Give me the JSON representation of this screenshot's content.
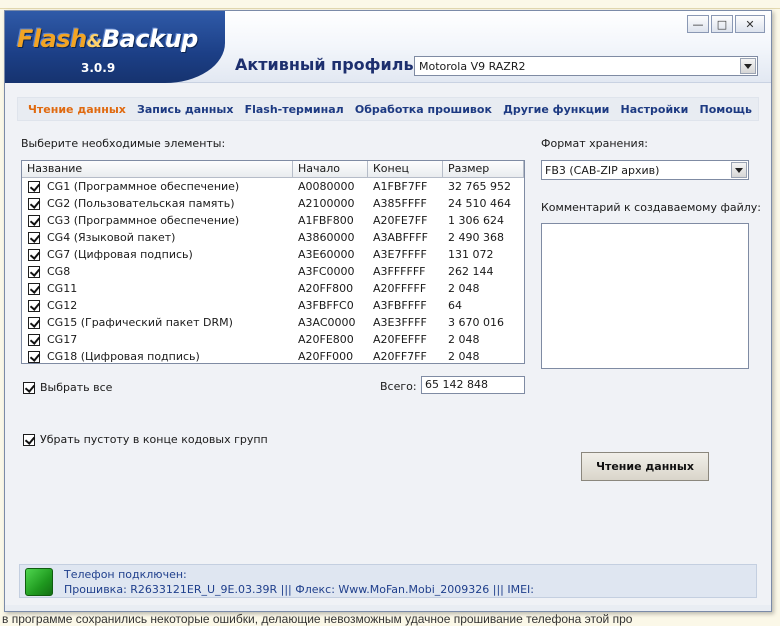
{
  "window": {
    "logo": {
      "part1": "Flash",
      "amp": "&",
      "part2": "Backup",
      "version": "3.0.9"
    },
    "buttons": {
      "minimize": "—",
      "maximize": "□",
      "close": "✕"
    }
  },
  "profile": {
    "label": "Активный профиль:",
    "selected": "Motorola V9 RAZR2"
  },
  "menu": [
    {
      "label": "Чтение данных",
      "active": true
    },
    {
      "label": "Запись данных",
      "active": false
    },
    {
      "label": "Flash-терминал",
      "active": false
    },
    {
      "label": "Обработка прошивок",
      "active": false
    },
    {
      "label": "Другие функции",
      "active": false
    },
    {
      "label": "Настройки",
      "active": false
    },
    {
      "label": "Помощь",
      "active": false
    }
  ],
  "main": {
    "select_label": "Выберите необходимые элементы:",
    "table": {
      "headers": [
        "Название",
        "Начало",
        "Конец",
        "Размер"
      ],
      "rows": [
        {
          "name": "CG1 (Программное обеспечение)",
          "start": "A0080000",
          "end": "A1FBF7FF",
          "size": "32 765 952",
          "checked": true
        },
        {
          "name": "CG2 (Пользовательская память)",
          "start": "A2100000",
          "end": "A385FFFF",
          "size": "24 510 464",
          "checked": true
        },
        {
          "name": "CG3 (Программное обеспечение)",
          "start": "A1FBF800",
          "end": "A20FE7FF",
          "size": "1 306 624",
          "checked": true
        },
        {
          "name": "CG4 (Языковой пакет)",
          "start": "A3860000",
          "end": "A3ABFFFF",
          "size": "2 490 368",
          "checked": true
        },
        {
          "name": "CG7 (Цифровая подпись)",
          "start": "A3E60000",
          "end": "A3E7FFFF",
          "size": "131 072",
          "checked": true
        },
        {
          "name": "CG8",
          "start": "A3FC0000",
          "end": "A3FFFFFF",
          "size": "262 144",
          "checked": true
        },
        {
          "name": "CG11",
          "start": "A20FF800",
          "end": "A20FFFFF",
          "size": "2 048",
          "checked": true
        },
        {
          "name": "CG12",
          "start": "A3FBFFC0",
          "end": "A3FBFFFF",
          "size": "64",
          "checked": true
        },
        {
          "name": "CG15 (Графический пакет DRM)",
          "start": "A3AC0000",
          "end": "A3E3FFFF",
          "size": "3 670 016",
          "checked": true
        },
        {
          "name": "CG17",
          "start": "A20FE800",
          "end": "A20FEFFF",
          "size": "2 048",
          "checked": true
        },
        {
          "name": "CG18 (Цифровая подпись)",
          "start": "A20FF000",
          "end": "A20FF7FF",
          "size": "2 048",
          "checked": true
        }
      ]
    },
    "select_all_label": "Выбрать все",
    "total_label": "Всего:",
    "total_value": "65 142 848",
    "trim_label": "Убрать пустоту в конце кодовых групп"
  },
  "side": {
    "format_label": "Формат хранения:",
    "format_selected": "FB3 (CAB-ZIP архив)",
    "comment_label": "Комментарий к создаваемому файлу:",
    "comment_value": ""
  },
  "action_button": "Чтение данных",
  "status": {
    "line1": "Телефон подключен:",
    "line2": "Прошивка: R2633121ER_U_9E.03.39R ||| Флекс: Www.MoFan.Mobi_2009326 ||| IMEI:"
  },
  "background": {
    "bottom_text": "в программе сохранились некоторые ошибки, делающие невозможным удачное прошивание телефона этой про"
  }
}
